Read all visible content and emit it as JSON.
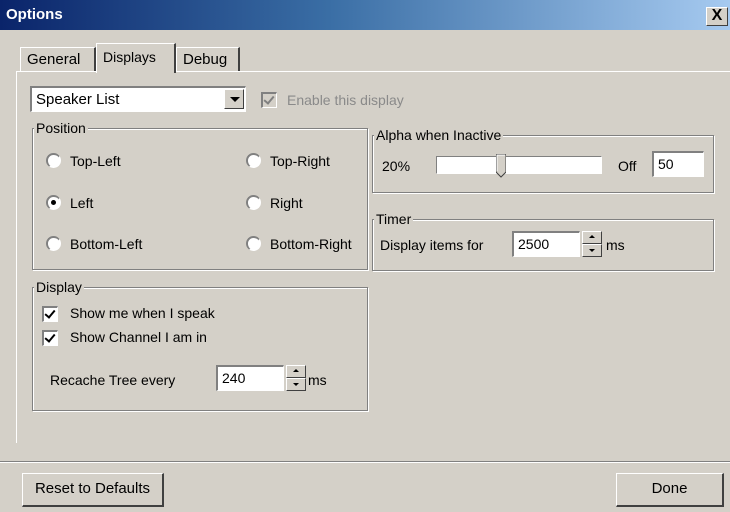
{
  "window": {
    "title": "Options",
    "close_glyph": "X"
  },
  "tabs": [
    {
      "label": "General",
      "active": false
    },
    {
      "label": "Displays",
      "active": true
    },
    {
      "label": "Debug",
      "active": false
    }
  ],
  "display_select": {
    "value": "Speaker List"
  },
  "enable_display": {
    "label": "Enable this display",
    "checked": true,
    "disabled": true
  },
  "position": {
    "legend": "Position",
    "options": [
      {
        "label": "Top-Left",
        "selected": false
      },
      {
        "label": "Top-Right",
        "selected": false
      },
      {
        "label": "Left",
        "selected": true
      },
      {
        "label": "Right",
        "selected": false
      },
      {
        "label": "Bottom-Left",
        "selected": false
      },
      {
        "label": "Bottom-Right",
        "selected": false
      }
    ]
  },
  "display_group": {
    "legend": "Display",
    "show_me_speak": {
      "label": "Show me when I speak",
      "checked": true
    },
    "show_channel": {
      "label": "Show Channel I am in",
      "checked": true
    },
    "recache": {
      "label": "Recache Tree every",
      "value": "240",
      "unit": "ms"
    }
  },
  "alpha": {
    "legend": "Alpha when Inactive",
    "min_label": "20%",
    "max_label": "Off",
    "value": "50",
    "slider_fraction": 0.38
  },
  "timer": {
    "legend": "Timer",
    "label": "Display items for",
    "value": "2500",
    "unit": "ms"
  },
  "buttons": {
    "reset": "Reset to Defaults",
    "done": "Done"
  },
  "icons": {
    "close": "close-icon",
    "dropdown": "chevron-down-icon",
    "spin_up": "spin-up-icon",
    "spin_down": "spin-down-icon"
  }
}
